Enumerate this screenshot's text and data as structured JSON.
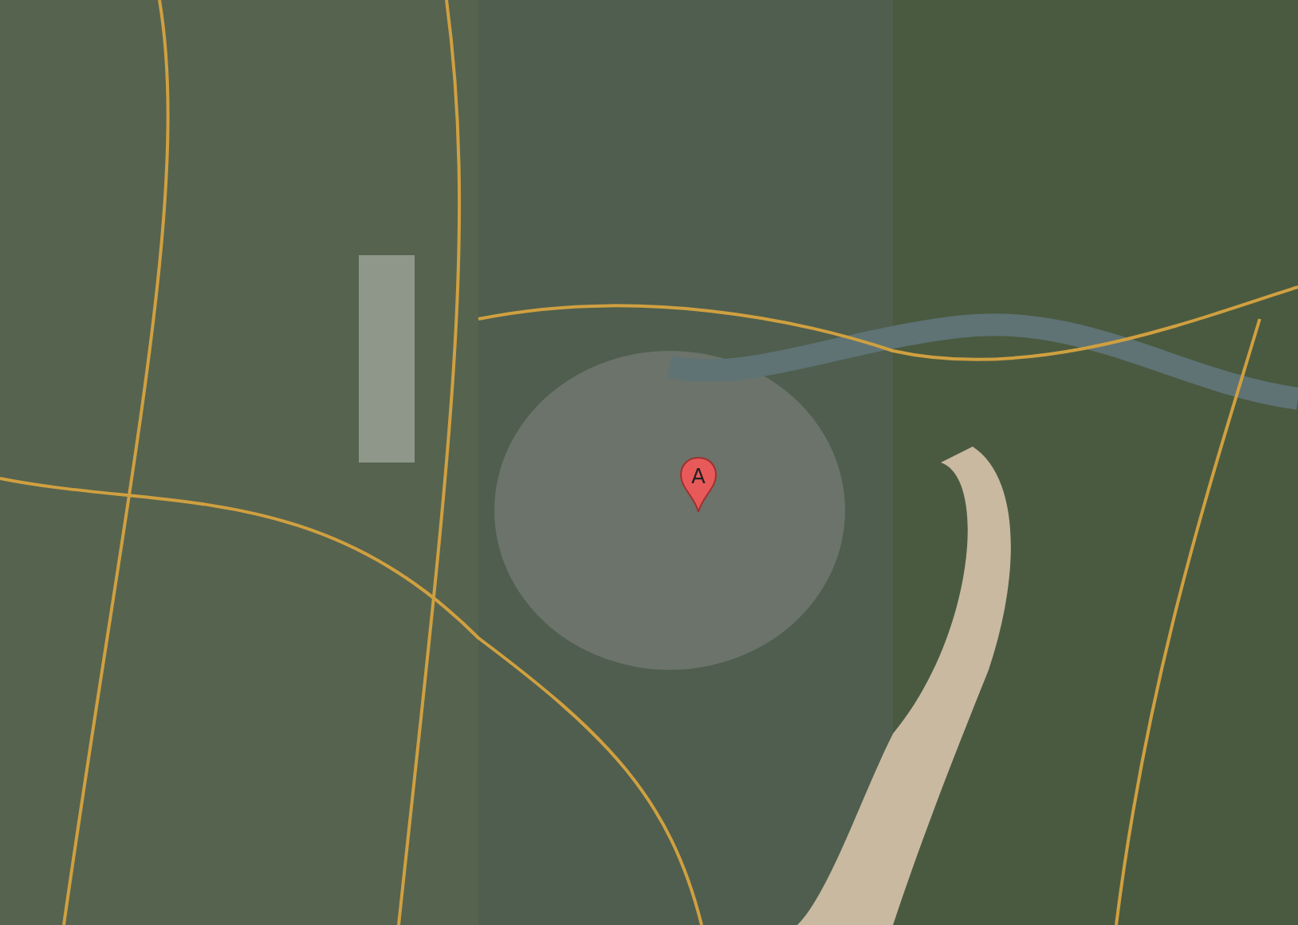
{
  "map": {
    "marker": {
      "label": "A"
    }
  }
}
